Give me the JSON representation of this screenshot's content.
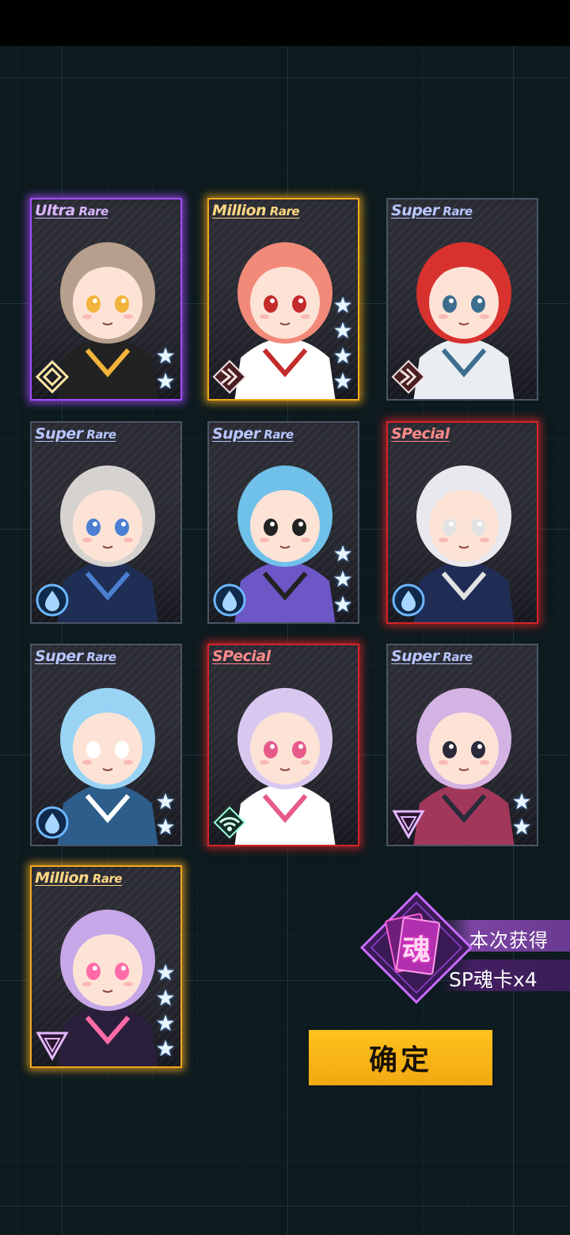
{
  "screen": {
    "background_color": "#0d1a1e",
    "grid_color": "#3c9696"
  },
  "cards": [
    {
      "rarity": "Ultra",
      "rarity_suffix": "Rare",
      "tier": "ur",
      "stars": 2,
      "badge": "diamond-badge-icon",
      "palette": [
        "#b79f8e",
        "#222",
        "#f2b43b"
      ]
    },
    {
      "rarity": "Million",
      "rarity_suffix": "Rare",
      "tier": "mr",
      "stars": 4,
      "badge": "rank-stripes-icon",
      "palette": [
        "#f28a7a",
        "#ffffff",
        "#c42b2b"
      ]
    },
    {
      "rarity": "Super",
      "rarity_suffix": "Rare",
      "tier": "sr",
      "stars": 0,
      "badge": "rank-stripes-icon",
      "palette": [
        "#d8322f",
        "#e9eef3",
        "#3d6d8f"
      ]
    },
    {
      "rarity": "Super",
      "rarity_suffix": "Rare",
      "tier": "sr",
      "stars": 0,
      "badge": "water-drop-badge-icon",
      "palette": [
        "#d6d2cf",
        "#1f2e55",
        "#4b7fd1"
      ]
    },
    {
      "rarity": "Super",
      "rarity_suffix": "Rare",
      "tier": "sr",
      "stars": 3,
      "badge": "water-drop-badge-icon",
      "palette": [
        "#6fc1ea",
        "#6d56c6",
        "#222"
      ]
    },
    {
      "rarity": "SPecial",
      "rarity_suffix": "",
      "tier": "sp",
      "stars": 0,
      "badge": "water-drop-badge-icon",
      "palette": [
        "#e8e8ee",
        "#1f2d55",
        "#e2e2e2"
      ]
    },
    {
      "rarity": "Super",
      "rarity_suffix": "Rare",
      "tier": "sr",
      "stars": 2,
      "badge": "water-drop-badge-icon",
      "palette": [
        "#9ad4f5",
        "#2c5d8b",
        "#ffffff"
      ]
    },
    {
      "rarity": "SPecial",
      "rarity_suffix": "",
      "tier": "sp",
      "stars": 0,
      "badge": "wifi-badge-icon",
      "palette": [
        "#d8c8f0",
        "#ffffff",
        "#e65a8a"
      ]
    },
    {
      "rarity": "Super",
      "rarity_suffix": "Rare",
      "tier": "sr",
      "stars": 2,
      "badge": "triangle-badge-icon",
      "palette": [
        "#d3b2e4",
        "#a1385b",
        "#2a2a3a"
      ]
    },
    {
      "rarity": "Million",
      "rarity_suffix": "Rare",
      "tier": "mr",
      "stars": 4,
      "badge": "triangle-badge-icon",
      "palette": [
        "#c6a7e8",
        "#2a1f3a",
        "#ff6ba8"
      ]
    }
  ],
  "reward": {
    "glyph": "魂",
    "title": "本次获得",
    "subtitle": "SP魂卡x4"
  },
  "confirm_label": "确定"
}
